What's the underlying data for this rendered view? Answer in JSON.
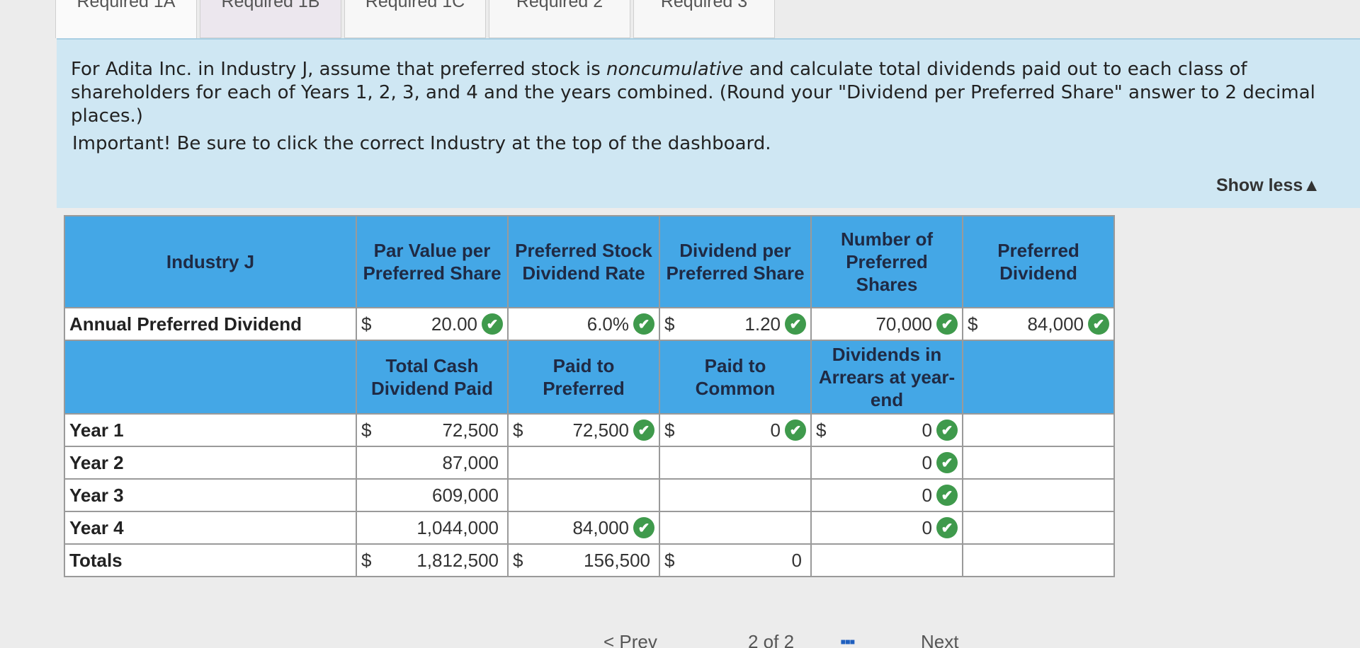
{
  "tabs": [
    "Required 1A",
    "Required 1B",
    "Required 1C",
    "Required 2",
    "Required 3"
  ],
  "instructions": {
    "part1": "For Adita Inc. in Industry J, assume that preferred stock is ",
    "emphasis": "noncumulative",
    "part2": " and calculate total dividends paid out to each class of shareholders for each of Years 1, 2, 3, and 4 and the years combined. (Round your \"Dividend per Preferred Share\" answer to 2 decimal places.)",
    "important": "Important! Be sure to click the correct Industry at the top of the dashboard."
  },
  "show_less": "Show less▲",
  "table": {
    "header1": {
      "industry": "Industry J",
      "par_value": "Par Value per Preferred Share",
      "rate": "Preferred Stock Dividend Rate",
      "dps": "Dividend per Preferred Share",
      "num_shares": "Number of Preferred Shares",
      "pref_div": "Preferred Dividend"
    },
    "annual_row": {
      "label": "Annual Preferred Dividend",
      "par_cur": "$",
      "par_val": "20.00",
      "rate_val": "6.0%",
      "dps_cur": "$",
      "dps_val": "1.20",
      "shares_val": "70,000",
      "div_cur": "$",
      "div_val": "84,000"
    },
    "header2": {
      "total_cash": "Total Cash Dividend Paid",
      "paid_pref": "Paid to Preferred",
      "paid_common": "Paid to Common",
      "arrears": "Dividends in Arrears at year-end"
    },
    "rows": [
      {
        "label": "Year 1",
        "total_cur": "$",
        "total": "72,500",
        "pref_cur": "$",
        "pref": "72,500",
        "common_cur": "$",
        "common": "0",
        "arrears_cur": "$",
        "arrears": "0"
      },
      {
        "label": "Year 2",
        "total_cur": "",
        "total": "87,000",
        "pref_cur": "",
        "pref": "",
        "common_cur": "",
        "common": "",
        "arrears_cur": "",
        "arrears": "0"
      },
      {
        "label": "Year 3",
        "total_cur": "",
        "total": "609,000",
        "pref_cur": "",
        "pref": "",
        "common_cur": "",
        "common": "",
        "arrears_cur": "",
        "arrears": "0"
      },
      {
        "label": "Year 4",
        "total_cur": "",
        "total": "1,044,000",
        "pref_cur": "",
        "pref": "84,000",
        "common_cur": "",
        "common": "",
        "arrears_cur": "",
        "arrears": "0"
      }
    ],
    "totals": {
      "label": "Totals",
      "total_cur": "$",
      "total": "1,812,500",
      "pref_cur": "$",
      "pref": "156,500",
      "common_cur": "$",
      "common": "0"
    }
  },
  "nav": {
    "prev": "< Prev",
    "page": "2 of 2",
    "next": "Next"
  }
}
